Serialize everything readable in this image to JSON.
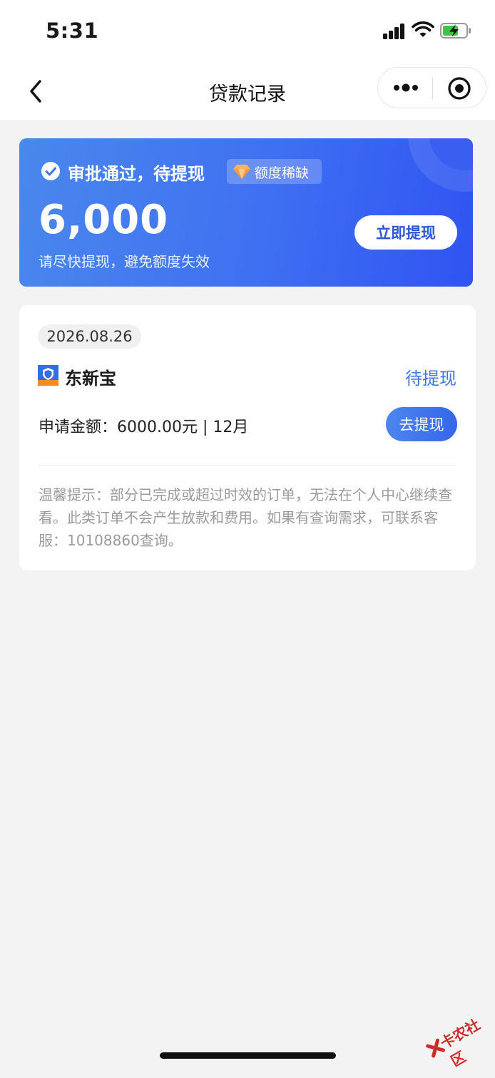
{
  "status_bar": {
    "time": "5:31"
  },
  "nav": {
    "title": "贷款记录"
  },
  "banner": {
    "approve_text": "审批通过，待提现",
    "scarce_badge": "额度稀缺",
    "amount": "6,000",
    "hint": "请尽快提现，避免额度失效",
    "button_label": "立即提现"
  },
  "record": {
    "date": "2026.08.26",
    "brand": "东新宝",
    "status": "待提现",
    "apply_info": "申请金额：6000.00元 | 12月",
    "button_label": "去提现",
    "tip": "温馨提示：部分已完成或超过时效的订单，无法在个人中心继续查看。此类订单不会产生放款和费用。如果有查询需求，可联系客服：10108860查询。"
  },
  "watermark": {
    "text": "卡农社区"
  },
  "colors": {
    "page_bg": "#f3f3f3",
    "banner_start": "#4a88ec",
    "banner_end": "#2f54f2",
    "accent_blue": "#3d78e4",
    "tip_gray": "#9a9a9a"
  }
}
